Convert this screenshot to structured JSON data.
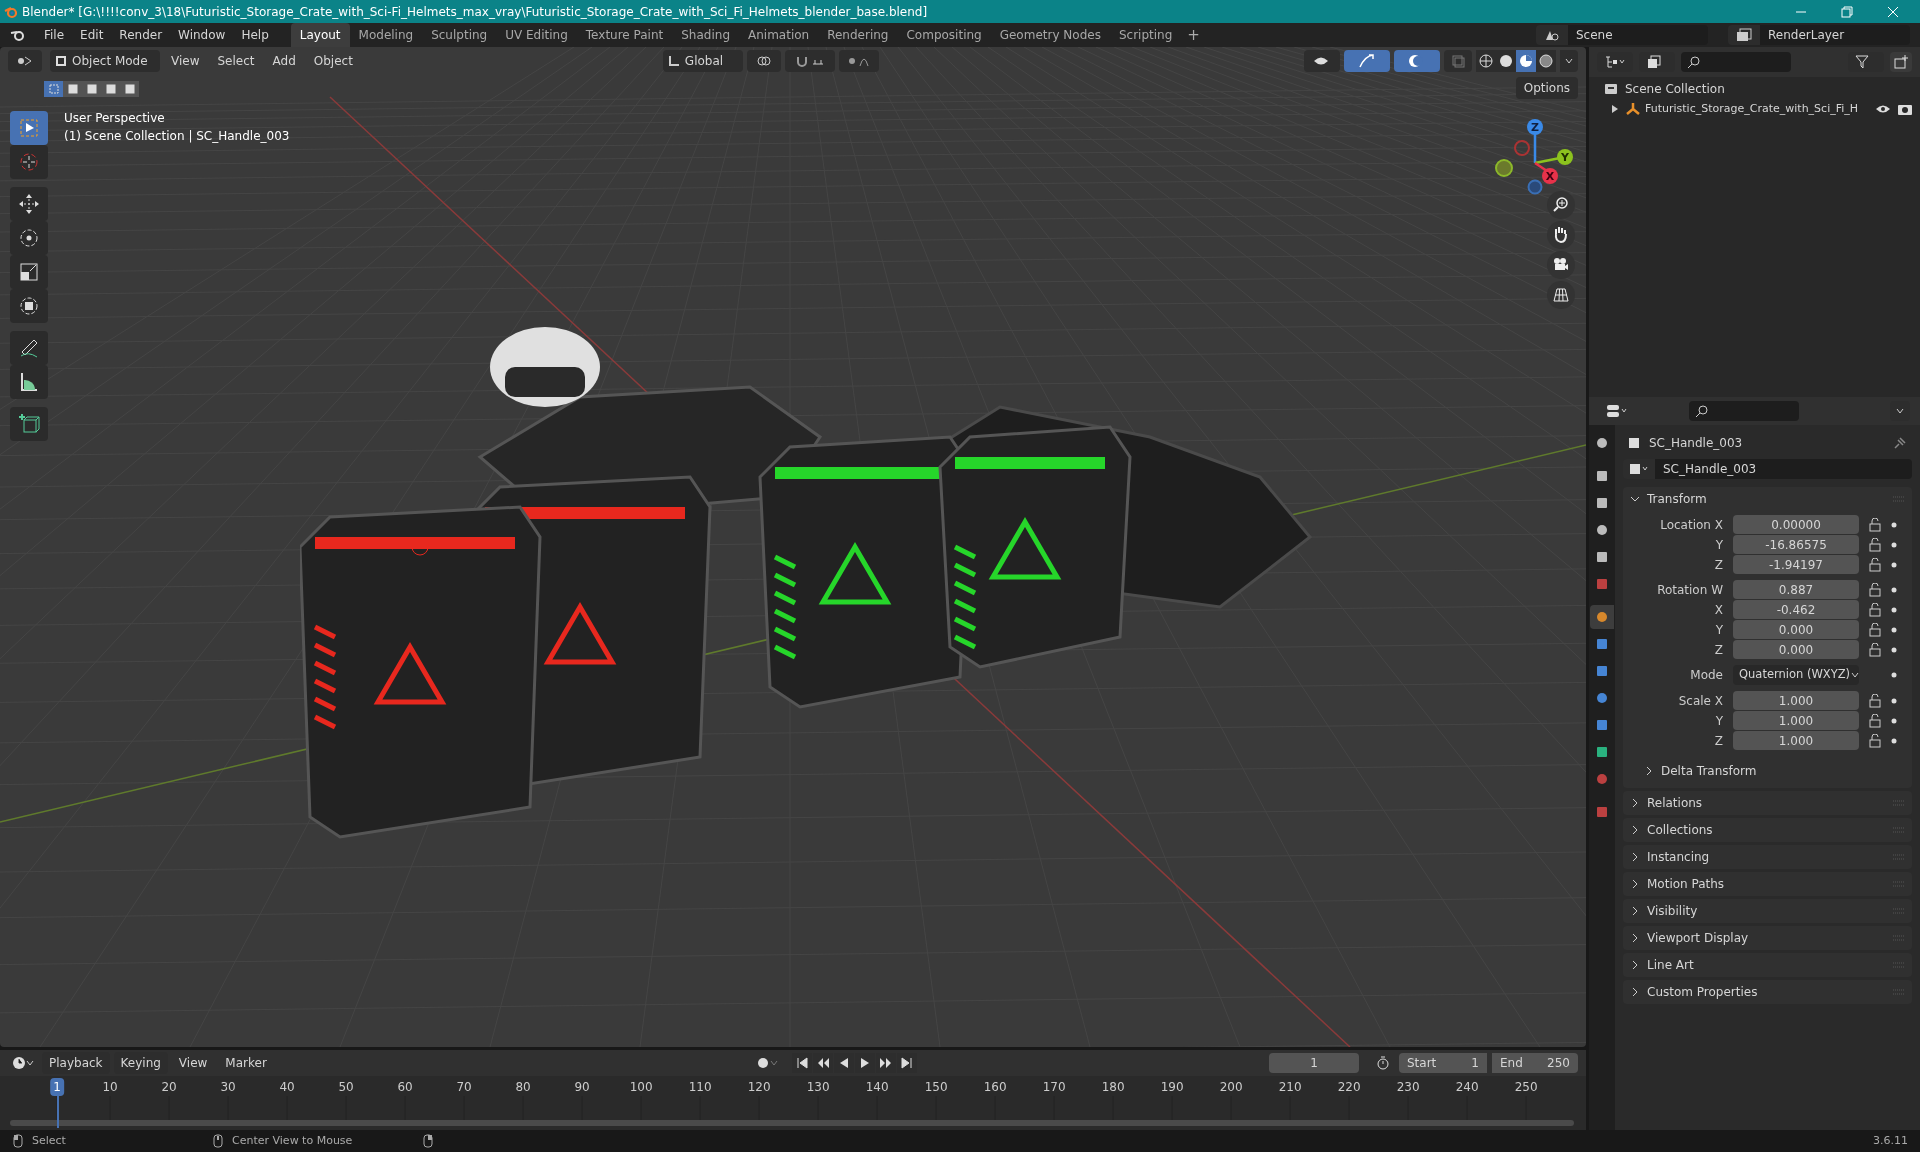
{
  "window": {
    "title": "Blender* [G:\\!!!!conv_3\\18\\Futuristic_Storage_Crate_with_Sci-Fi_Helmets_max_vray\\Futuristic_Storage_Crate_with_Sci_Fi_Helmets_blender_base.blend]"
  },
  "menu": [
    "File",
    "Edit",
    "Render",
    "Window",
    "Help"
  ],
  "workspaces": [
    {
      "label": "Layout",
      "selected": true
    },
    {
      "label": "Modeling",
      "selected": false
    },
    {
      "label": "Sculpting",
      "selected": false
    },
    {
      "label": "UV Editing",
      "selected": false
    },
    {
      "label": "Texture Paint",
      "selected": false
    },
    {
      "label": "Shading",
      "selected": false
    },
    {
      "label": "Animation",
      "selected": false
    },
    {
      "label": "Rendering",
      "selected": false
    },
    {
      "label": "Compositing",
      "selected": false
    },
    {
      "label": "Geometry Nodes",
      "selected": false
    },
    {
      "label": "Scripting",
      "selected": false
    }
  ],
  "add_workspace": "+",
  "scene": "Scene",
  "view_layer": "RenderLayer",
  "viewport": {
    "mode": "Object Mode",
    "menus": [
      "View",
      "Select",
      "Add",
      "Object"
    ],
    "orientation": "Global",
    "options": "Options",
    "select_modes": [
      {
        "selected": true
      },
      {
        "selected": false
      },
      {
        "selected": false
      },
      {
        "selected": false
      },
      {
        "selected": false
      }
    ],
    "shading": [
      {
        "selected": false
      },
      {
        "selected": false
      },
      {
        "selected": true
      },
      {
        "selected": false
      }
    ],
    "tools": [
      {
        "selected": true
      },
      {
        "selected": false
      },
      {
        "selected": false
      },
      {
        "selected": false
      },
      {
        "selected": false
      },
      {
        "selected": false
      },
      {
        "selected": false
      },
      {
        "selected": false
      },
      {
        "selected": false
      }
    ],
    "info": [
      "User Perspective",
      "(1) Scene Collection | SC_Handle_003"
    ],
    "gizmo": [
      "Z",
      "Y",
      "X"
    ]
  },
  "outliner": {
    "root": "Scene Collection",
    "children": [
      {
        "label": "Futuristic_Storage_Crate_with_Sci_Fi_H",
        "expanded": false
      }
    ]
  },
  "properties": {
    "tabs": [
      {
        "selected": false
      },
      {
        "selected": false
      },
      {
        "selected": false
      },
      {
        "selected": false
      },
      {
        "selected": false
      },
      {
        "selected": false
      },
      {
        "selected": true
      },
      {
        "selected": false
      },
      {
        "selected": false
      },
      {
        "selected": false
      },
      {
        "selected": false
      },
      {
        "selected": false
      },
      {
        "selected": false
      },
      {
        "selected": false
      }
    ],
    "object_name": "SC_Handle_003",
    "data_name": "SC_Handle_003",
    "transform": {
      "title": "Transform",
      "expanded": true,
      "groups": [
        {
          "rows": [
            {
              "label": "Location X",
              "value": "0.00000"
            },
            {
              "label": "Y",
              "value": "-16.86575"
            },
            {
              "label": "Z",
              "value": "-1.94197"
            }
          ]
        },
        {
          "rows": [
            {
              "label": "Rotation W",
              "value": "0.887"
            },
            {
              "label": "X",
              "value": "-0.462"
            },
            {
              "label": "Y",
              "value": "0.000"
            },
            {
              "label": "Z",
              "value": "0.000"
            }
          ]
        },
        {
          "mode_label": "Mode",
          "mode_value": "Quaternion (WXYZ)"
        },
        {
          "rows": [
            {
              "label": "Scale X",
              "value": "1.000"
            },
            {
              "label": "Y",
              "value": "1.000"
            },
            {
              "label": "Z",
              "value": "1.000"
            }
          ]
        }
      ],
      "subpanel": "Delta Transform"
    },
    "panels": [
      "Relations",
      "Collections",
      "Instancing",
      "Motion Paths",
      "Visibility",
      "Viewport Display",
      "Line Art",
      "Custom Properties"
    ]
  },
  "timeline": {
    "menus": [
      "Playback",
      "Keying",
      "View",
      "Marker"
    ],
    "current_frame": "1",
    "start_label": "Start",
    "start": "1",
    "end_label": "End",
    "end": "250",
    "ticks": [
      "1",
      "10",
      "20",
      "30",
      "40",
      "50",
      "60",
      "70",
      "80",
      "90",
      "100",
      "110",
      "120",
      "130",
      "140",
      "150",
      "160",
      "170",
      "180",
      "190",
      "200",
      "210",
      "220",
      "230",
      "240",
      "250"
    ]
  },
  "status_bar": {
    "items": [
      "Select",
      "Center View to Mouse"
    ],
    "version": "3.6.11"
  }
}
